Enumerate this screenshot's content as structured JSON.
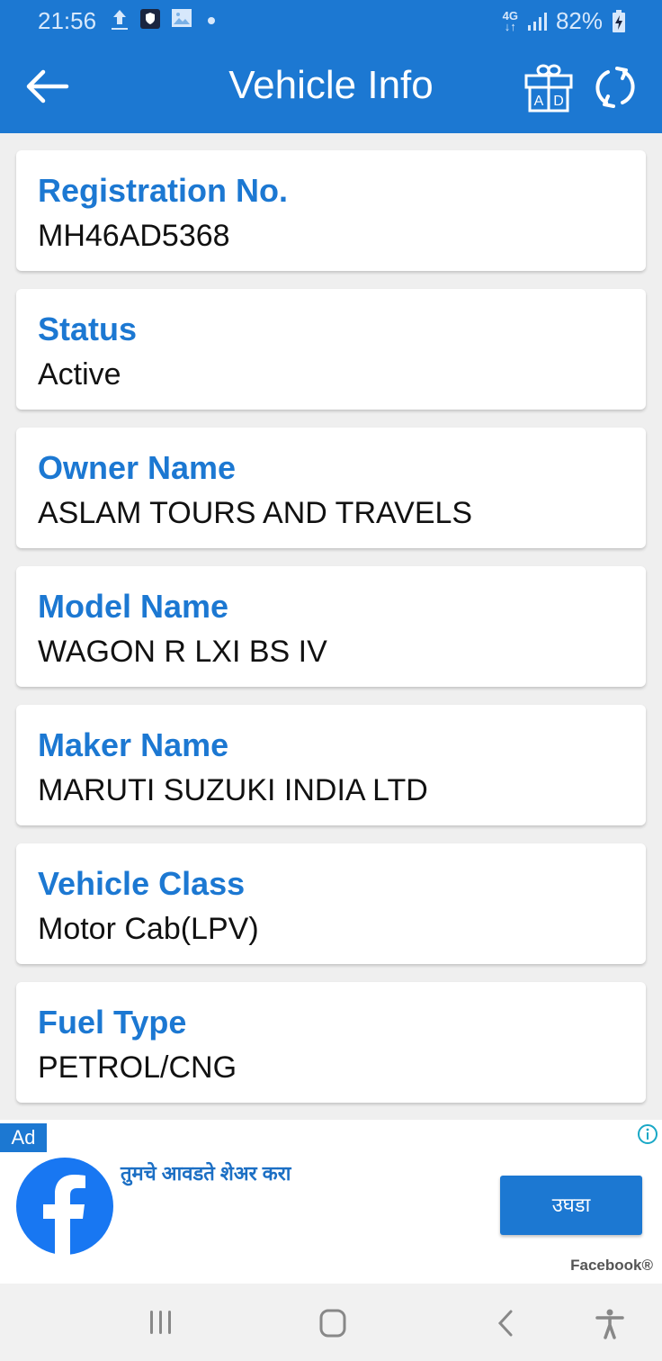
{
  "status_bar": {
    "time": "21:56",
    "network": "4G",
    "battery": "82%",
    "icons": [
      "upload-icon",
      "shield-app-icon",
      "gallery-icon",
      "dot-icon",
      "network-4g-icon",
      "signal-icon",
      "battery-charging-icon"
    ]
  },
  "app_bar": {
    "title": "Vehicle Info",
    "back_icon": "arrow-left-icon",
    "gift_icon": "gift-ad-icon",
    "gift_icon_text": "A D",
    "refresh_icon": "refresh-icon"
  },
  "fields": [
    {
      "label": "Registration No.",
      "value": "MH46AD5368"
    },
    {
      "label": "Status",
      "value": "Active"
    },
    {
      "label": "Owner Name",
      "value": "ASLAM TOURS AND TRAVELS"
    },
    {
      "label": "Model Name",
      "value": "WAGON R LXI BS IV"
    },
    {
      "label": "Maker Name",
      "value": "MARUTI SUZUKI INDIA LTD"
    },
    {
      "label": "Vehicle Class",
      "value": "Motor Cab(LPV)"
    },
    {
      "label": "Fuel Type",
      "value": "PETROL/CNG"
    }
  ],
  "ad": {
    "badge": "Ad",
    "headline": "तुमचे आवडते शेअर करा",
    "cta": "उघडा",
    "advertiser": "Facebook®",
    "brand_color": "#1877f2"
  },
  "nav_bar": {
    "icons": [
      "recents-icon",
      "home-icon",
      "back-icon",
      "accessibility-icon"
    ]
  },
  "colors": {
    "primary": "#1c78d2",
    "background": "#efefef"
  }
}
